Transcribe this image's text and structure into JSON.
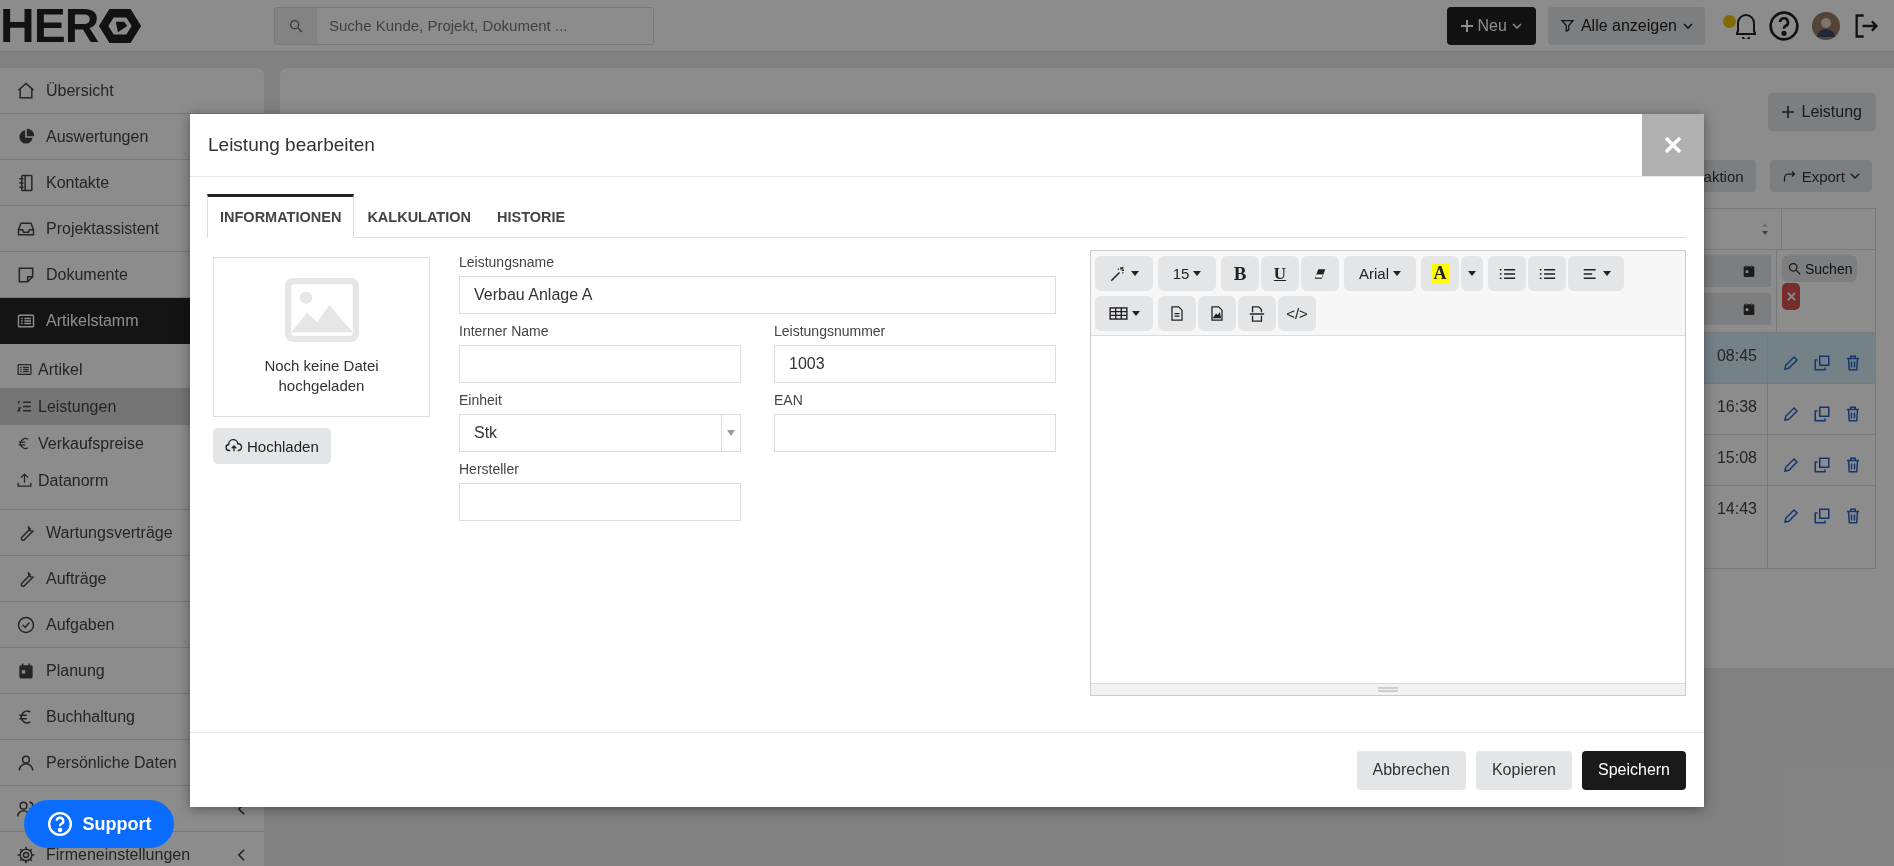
{
  "topbar": {
    "logo": "HER",
    "search": {
      "placeholder": "Suche Kunde, Projekt, Dokument ..."
    },
    "new_button": "Neu",
    "filter_button": "Alle anzeigen",
    "notification": true
  },
  "sidebar": {
    "items": [
      {
        "label": "Übersicht",
        "selected": false
      },
      {
        "label": "Auswertungen",
        "selected": false
      },
      {
        "label": "Kontakte",
        "selected": false
      },
      {
        "label": "Projektassistent",
        "selected": false
      },
      {
        "label": "Dokumente",
        "selected": false
      },
      {
        "label": "Artikelstamm",
        "selected": true,
        "children": [
          {
            "label": "Artikel",
            "selected": false
          },
          {
            "label": "Leistungen",
            "selected": true
          },
          {
            "label": "Verkaufspreise",
            "selected": false
          },
          {
            "label": "Datanorm",
            "selected": false
          }
        ]
      },
      {
        "label": "Wartungsverträge",
        "selected": false
      },
      {
        "label": "Aufträge",
        "selected": false
      },
      {
        "label": "Aufgaben",
        "selected": false
      },
      {
        "label": "Planung",
        "selected": false
      },
      {
        "label": "Buchhaltung",
        "selected": false
      },
      {
        "label": "Persönliche Daten",
        "selected": false
      },
      {
        "selected": false,
        "expandable": true
      },
      {
        "label": "Firmeneinstellungen",
        "selected": false,
        "expandable": true
      }
    ]
  },
  "support_button": "Support",
  "page": {
    "add_button": "Leistung",
    "action_button": "aktion",
    "export_button": "Export",
    "search_button": "Suchen",
    "rows": [
      {
        "time": "08:45",
        "selected": true
      },
      {
        "time": "16:38",
        "selected": false
      },
      {
        "time": "15:08",
        "selected": false
      },
      {
        "time": "14:43",
        "selected": false
      }
    ]
  },
  "modal": {
    "title": "Leistung bearbeiten",
    "tabs": [
      {
        "label": "INFORMATIONEN",
        "selected": true
      },
      {
        "label": "KALKULATION",
        "selected": false
      },
      {
        "label": "HISTORIE",
        "selected": false
      }
    ],
    "image_caption": "Noch keine Datei hochgeladen",
    "upload_button": "Hochladen",
    "fields": [
      {
        "label": "Leistungsname",
        "value": "Verbau Anlage A",
        "kind": "wide"
      },
      {
        "label": "Interner Name",
        "kind": "text"
      },
      {
        "label": "Leistungsnummer",
        "value": "1003",
        "kind": "text"
      },
      {
        "label": "Einheit",
        "value": "Stk",
        "kind": "select"
      },
      {
        "label": "EAN",
        "kind": "text"
      },
      {
        "label": "Hersteller",
        "kind": "text"
      }
    ],
    "toolbar": [
      [
        [
          {
            "kind": "magic",
            "dropdown": true
          }
        ],
        [
          {
            "kind": "size",
            "text": "15",
            "dropdown": true
          }
        ],
        [
          {
            "kind": "bold",
            "text": "B"
          },
          {
            "kind": "underline",
            "text": "U"
          },
          {
            "kind": "eraser"
          }
        ],
        [
          {
            "kind": "font",
            "text": "Arial",
            "dropdown": true
          }
        ],
        [
          {
            "kind": "color",
            "text": "A"
          },
          {
            "kind": "caret",
            "dropdown": true
          }
        ],
        [
          {
            "kind": "bullets"
          },
          {
            "kind": "numbers"
          },
          {
            "kind": "align",
            "dropdown": true
          }
        ]
      ],
      [
        [
          {
            "kind": "table",
            "dropdown": true
          }
        ],
        [
          {
            "kind": "doc"
          },
          {
            "kind": "image"
          },
          {
            "kind": "pagebreak"
          },
          {
            "kind": "code",
            "text": "</>"
          }
        ]
      ]
    ],
    "buttons": [
      {
        "label": "Abbrechen",
        "kind": "secondary"
      },
      {
        "label": "Kopieren",
        "kind": "secondary"
      },
      {
        "label": "Speichern",
        "kind": "primary"
      }
    ]
  }
}
